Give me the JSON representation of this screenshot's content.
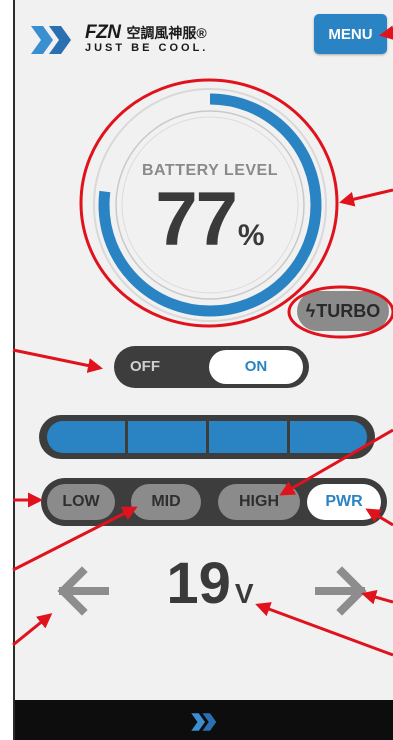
{
  "header": {
    "brand_name": "FZN",
    "brand_chinese": "空調風神服®",
    "tagline": "JUST BE COOL.",
    "menu_label": "MENU"
  },
  "battery": {
    "label": "BATTERY LEVEL",
    "value": "77",
    "unit": "%",
    "level_fraction": 0.77
  },
  "turbo": {
    "label": "TURBO"
  },
  "power_toggle": {
    "off_label": "OFF",
    "on_label": "ON",
    "state": "ON"
  },
  "fan_level": {
    "segments_total": 4,
    "segments_filled": 4
  },
  "modes": {
    "items": [
      "LOW",
      "MID",
      "HIGH",
      "PWR"
    ],
    "selected": "PWR"
  },
  "voltage": {
    "value": "19",
    "unit": "V"
  },
  "colors": {
    "accent": "#2a84c4",
    "dark_control": "#3d3d3d",
    "inactive_button": "#8b8b8b",
    "annotation": "#e0121c",
    "background": "#f1f1f1"
  },
  "icons": {
    "logo": "fzn-logo-icon",
    "turbo": "lightning-icon",
    "decrease": "arrow-left-icon",
    "increase": "arrow-right-icon"
  }
}
